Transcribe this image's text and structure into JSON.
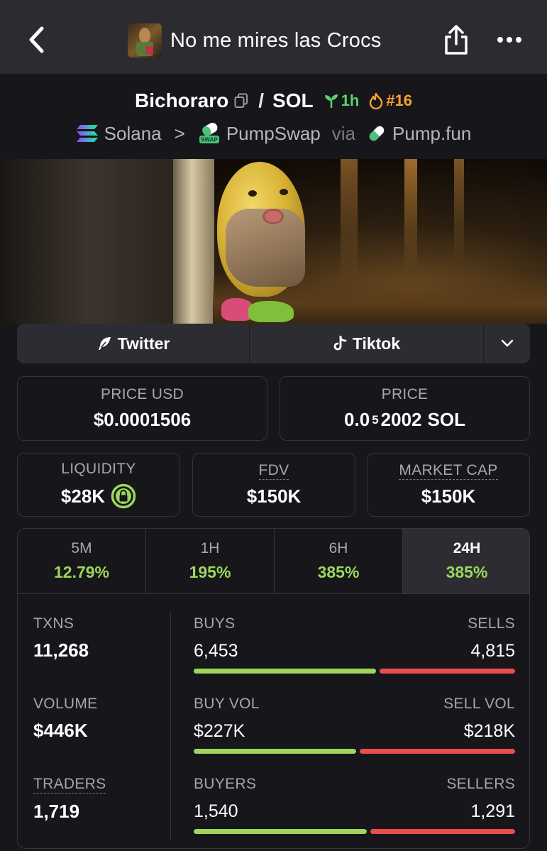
{
  "header": {
    "title": "No me mires las Crocs"
  },
  "pair": {
    "token": "Bichoraro",
    "separator": "/",
    "quote": "SOL",
    "age": "1h",
    "rank": "#16"
  },
  "chain": {
    "network": "Solana",
    "chevron": ">",
    "dex": "PumpSwap",
    "via": "via",
    "launchpad": "Pump.fun"
  },
  "social": {
    "twitter": "Twitter",
    "tiktok": "Tiktok"
  },
  "price_usd": {
    "label": "PRICE USD",
    "value": "$0.0001506"
  },
  "price_native": {
    "label": "PRICE",
    "prefix": "0.0",
    "zeros": "5",
    "digits": "2002",
    "unit": "SOL"
  },
  "liquidity": {
    "label": "LIQUIDITY",
    "value": "$28K"
  },
  "fdv": {
    "label": "FDV",
    "value": "$150K"
  },
  "market_cap": {
    "label": "MARKET CAP",
    "value": "$150K"
  },
  "tabs": [
    {
      "label": "5M",
      "value": "12.79%"
    },
    {
      "label": "1H",
      "value": "195%"
    },
    {
      "label": "6H",
      "value": "385%"
    },
    {
      "label": "24H",
      "value": "385%"
    }
  ],
  "stats": {
    "txns_label": "TXNS",
    "txns": "11,268",
    "volume_label": "VOLUME",
    "volume": "$446K",
    "traders_label": "TRADERS",
    "traders": "1,719"
  },
  "splits": [
    {
      "left_label": "BUYS",
      "right_label": "SELLS",
      "left": "6,453",
      "right": "4,815",
      "left_ratio": 0.573
    },
    {
      "left_label": "BUY VOL",
      "right_label": "SELL VOL",
      "left": "$227K",
      "right": "$218K",
      "left_ratio": 0.51
    },
    {
      "left_label": "BUYERS",
      "right_label": "SELLERS",
      "left": "1,540",
      "right": "1,291",
      "left_ratio": 0.544
    }
  ],
  "colors": {
    "positive": "#9dd65a",
    "negative": "#ea4d4d",
    "age": "#5bd170",
    "rank": "#f7a22a"
  }
}
